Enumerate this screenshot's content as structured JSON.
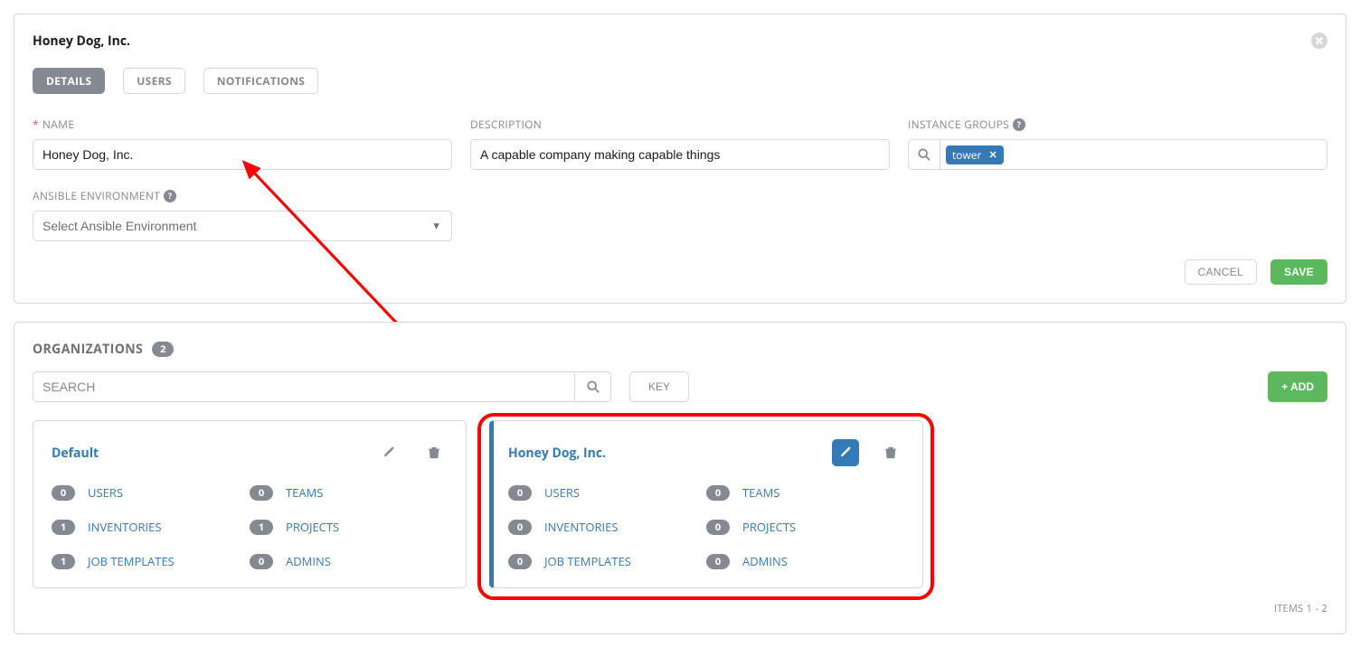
{
  "edit": {
    "title": "Honey Dog, Inc.",
    "tabs": [
      "DETAILS",
      "USERS",
      "NOTIFICATIONS"
    ],
    "fields": {
      "name_label": "NAME",
      "name_value": "Honey Dog, Inc.",
      "desc_label": "DESCRIPTION",
      "desc_value": "A capable company making capable things",
      "ig_label": "INSTANCE GROUPS",
      "ig_tag": "tower",
      "env_label": "ANSIBLE ENVIRONMENT",
      "env_placeholder": "Select Ansible Environment"
    },
    "cancel": "CANCEL",
    "save": "SAVE"
  },
  "orgs": {
    "title": "ORGANIZATIONS",
    "count": "2",
    "search_placeholder": "SEARCH",
    "key": "KEY",
    "add": "+ ADD",
    "items_text": "ITEMS  1 - 2",
    "cards": [
      {
        "title": "Default",
        "selected": false,
        "edit_primary": false,
        "stats": [
          {
            "count": "0",
            "label": "USERS"
          },
          {
            "count": "0",
            "label": "TEAMS"
          },
          {
            "count": "1",
            "label": "INVENTORIES"
          },
          {
            "count": "1",
            "label": "PROJECTS"
          },
          {
            "count": "1",
            "label": "JOB TEMPLATES"
          },
          {
            "count": "0",
            "label": "ADMINS"
          }
        ]
      },
      {
        "title": "Honey Dog, Inc.",
        "selected": true,
        "edit_primary": true,
        "stats": [
          {
            "count": "0",
            "label": "USERS"
          },
          {
            "count": "0",
            "label": "TEAMS"
          },
          {
            "count": "0",
            "label": "INVENTORIES"
          },
          {
            "count": "0",
            "label": "PROJECTS"
          },
          {
            "count": "0",
            "label": "JOB TEMPLATES"
          },
          {
            "count": "0",
            "label": "ADMINS"
          }
        ]
      }
    ]
  }
}
